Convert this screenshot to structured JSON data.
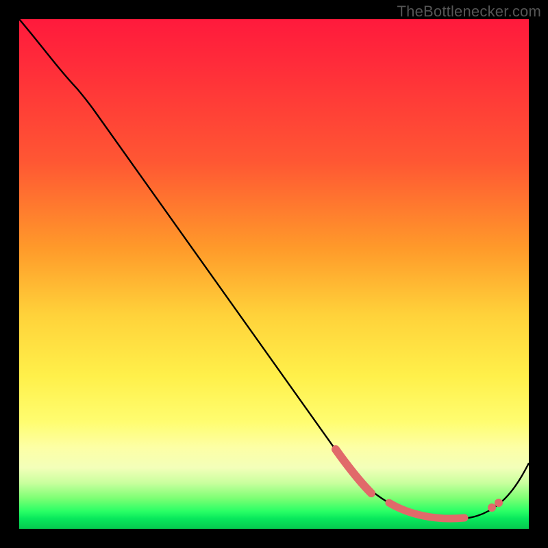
{
  "watermark": "TheBottlenecker.com",
  "chart_data": {
    "type": "line",
    "title": "",
    "xlabel": "",
    "ylabel": "",
    "xlim": [
      0,
      100
    ],
    "ylim": [
      0,
      100
    ],
    "series": [
      {
        "name": "curve",
        "x": [
          0,
          8,
          12,
          62,
          68,
          74,
          80,
          86,
          92,
          100
        ],
        "y": [
          100,
          92,
          88,
          16,
          10,
          6,
          4,
          4,
          6,
          14
        ]
      }
    ],
    "markers": [
      {
        "name": "segment-a-start",
        "x": 62,
        "y": 16
      },
      {
        "name": "segment-a-end",
        "x": 68,
        "y": 10
      },
      {
        "name": "segment-b-start",
        "x": 72,
        "y": 6
      },
      {
        "name": "segment-b-end",
        "x": 88,
        "y": 4
      },
      {
        "name": "point-right-a",
        "x": 92,
        "y": 6
      },
      {
        "name": "point-right-b",
        "x": 93,
        "y": 7
      }
    ],
    "gradient_stops": [
      {
        "pos": 0.0,
        "color": "#ff1a3c"
      },
      {
        "pos": 0.28,
        "color": "#ff5733"
      },
      {
        "pos": 0.58,
        "color": "#ffd23a"
      },
      {
        "pos": 0.79,
        "color": "#fffd70"
      },
      {
        "pos": 0.94,
        "color": "#7dff74"
      },
      {
        "pos": 1.0,
        "color": "#06c94f"
      }
    ]
  }
}
